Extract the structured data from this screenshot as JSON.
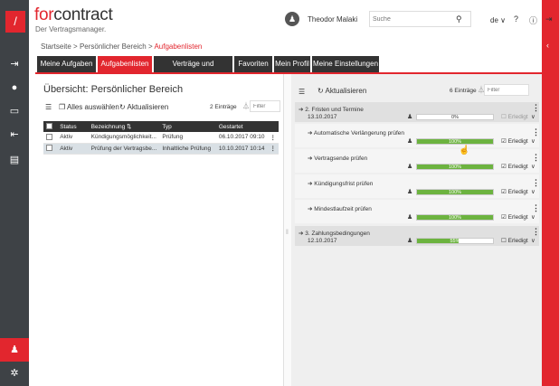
{
  "app": {
    "brand_prefix": "for",
    "brand_suffix": "contract",
    "tagline": "Der Vertragsmanager.",
    "user": "Theodor Malaki",
    "search_placeholder": "Suche",
    "lang": "de ∨"
  },
  "breadcrumb": {
    "home": "Startseite",
    "sep1": ">",
    "area": "Persönlicher Bereich",
    "sep2": ">",
    "current": "Aufgabenlisten"
  },
  "tabs": [
    {
      "label": "Meine Aufgaben"
    },
    {
      "label": "Aufgabenlisten"
    },
    {
      "label": "Verträge und Dokumente"
    },
    {
      "label": "Favoriten"
    },
    {
      "label": "Mein Profil"
    },
    {
      "label": "Meine Einstellungen"
    }
  ],
  "left": {
    "title": "Übersicht: Persönlicher Bereich",
    "select_all": "Alles auswählen",
    "refresh": "Aktualisieren",
    "count": "2 Einträge",
    "filter_placeholder": "Filter",
    "columns": [
      "Status",
      "Bezeichnung ⇅",
      "Typ",
      "Gestartet"
    ],
    "rows": [
      {
        "status": "Aktiv",
        "name": "Kündigungsmöglichkeit...",
        "type": "Prüfung",
        "started": "06.10.2017 09:10"
      },
      {
        "status": "Aktiv",
        "name": "Prüfung der Vertragsbe...",
        "type": "Inhaltliche Prüfung",
        "started": "10.10.2017 10:14"
      }
    ]
  },
  "right": {
    "refresh": "Aktualisieren",
    "count": "6 Einträge",
    "filter_placeholder": "Filter",
    "done_label": "Erledigt",
    "groups": [
      {
        "title": "2. Fristen und Termine",
        "date": "13.10.2017",
        "progress": 0,
        "progress_label": "0%",
        "done": false
      },
      {
        "title": "3. Zahlungsbedingungen",
        "date": "12.10.2017",
        "progress": 55,
        "progress_label": "55%",
        "done": false
      }
    ],
    "tasks": [
      {
        "title": "Automatische Verlängerung prüfen",
        "progress": 100,
        "progress_label": "100%",
        "done": true
      },
      {
        "title": "Vertragsende prüfen",
        "progress": 100,
        "progress_label": "100%",
        "done": true
      },
      {
        "title": "Kündigungsfrist prüfen",
        "progress": 100,
        "progress_label": "100%",
        "done": true
      },
      {
        "title": "Mindestlaufzeit prüfen",
        "progress": 100,
        "progress_label": "100%",
        "done": true
      }
    ]
  },
  "colors": {
    "accent": "#e2262e",
    "dark": "#333333",
    "progress": "#6cb33f"
  }
}
